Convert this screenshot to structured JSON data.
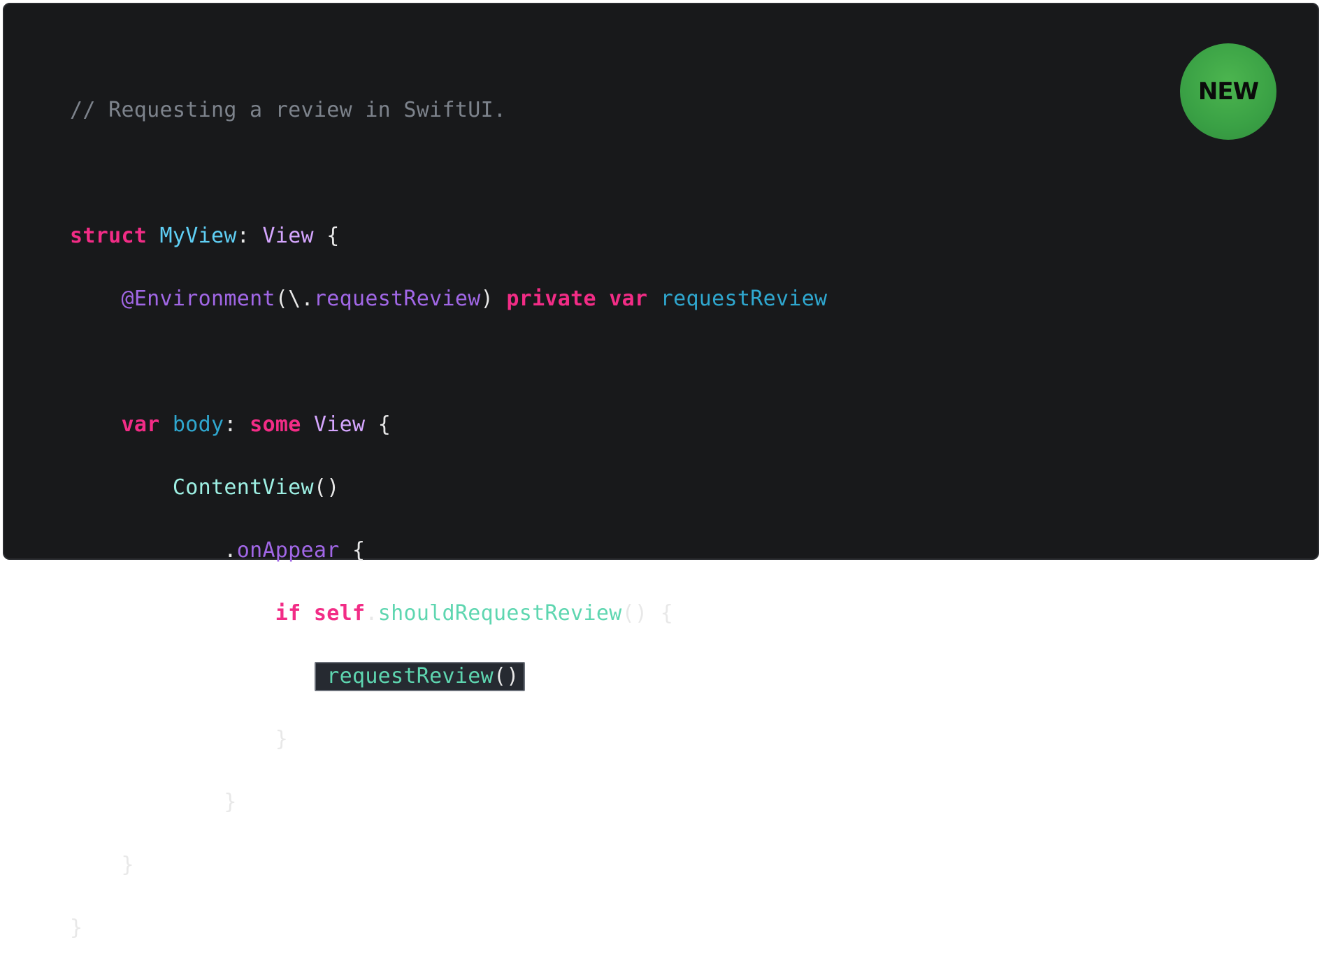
{
  "badge": {
    "label": "NEW",
    "color": "#3aa145"
  },
  "code": {
    "comment": "// Requesting a review in SwiftUI.",
    "l1": {
      "kw": "struct",
      "name": "MyView",
      "colon": ":",
      "type": "View",
      "brace": "{"
    },
    "l2": {
      "attr": "@Environment",
      "open": "(\\.",
      "key": "requestReview",
      "close": ")",
      "kw1": "private",
      "kw2": "var",
      "name": "requestReview"
    },
    "l4": {
      "kw": "var",
      "name": "body",
      "colon": ":",
      "kw2": "some",
      "type": "View",
      "brace": "{"
    },
    "l5": {
      "fn": "ContentView",
      "parens": "()"
    },
    "l6": {
      "dot": ".",
      "method": "onAppear",
      "brace": "{"
    },
    "l7": {
      "kw": "if",
      "kw2": "self",
      "dot": ".",
      "call": "shouldRequestReview",
      "parens": "()",
      "brace": "{"
    },
    "l8": {
      "call": "requestReview",
      "parens": "()"
    },
    "close": "}"
  }
}
